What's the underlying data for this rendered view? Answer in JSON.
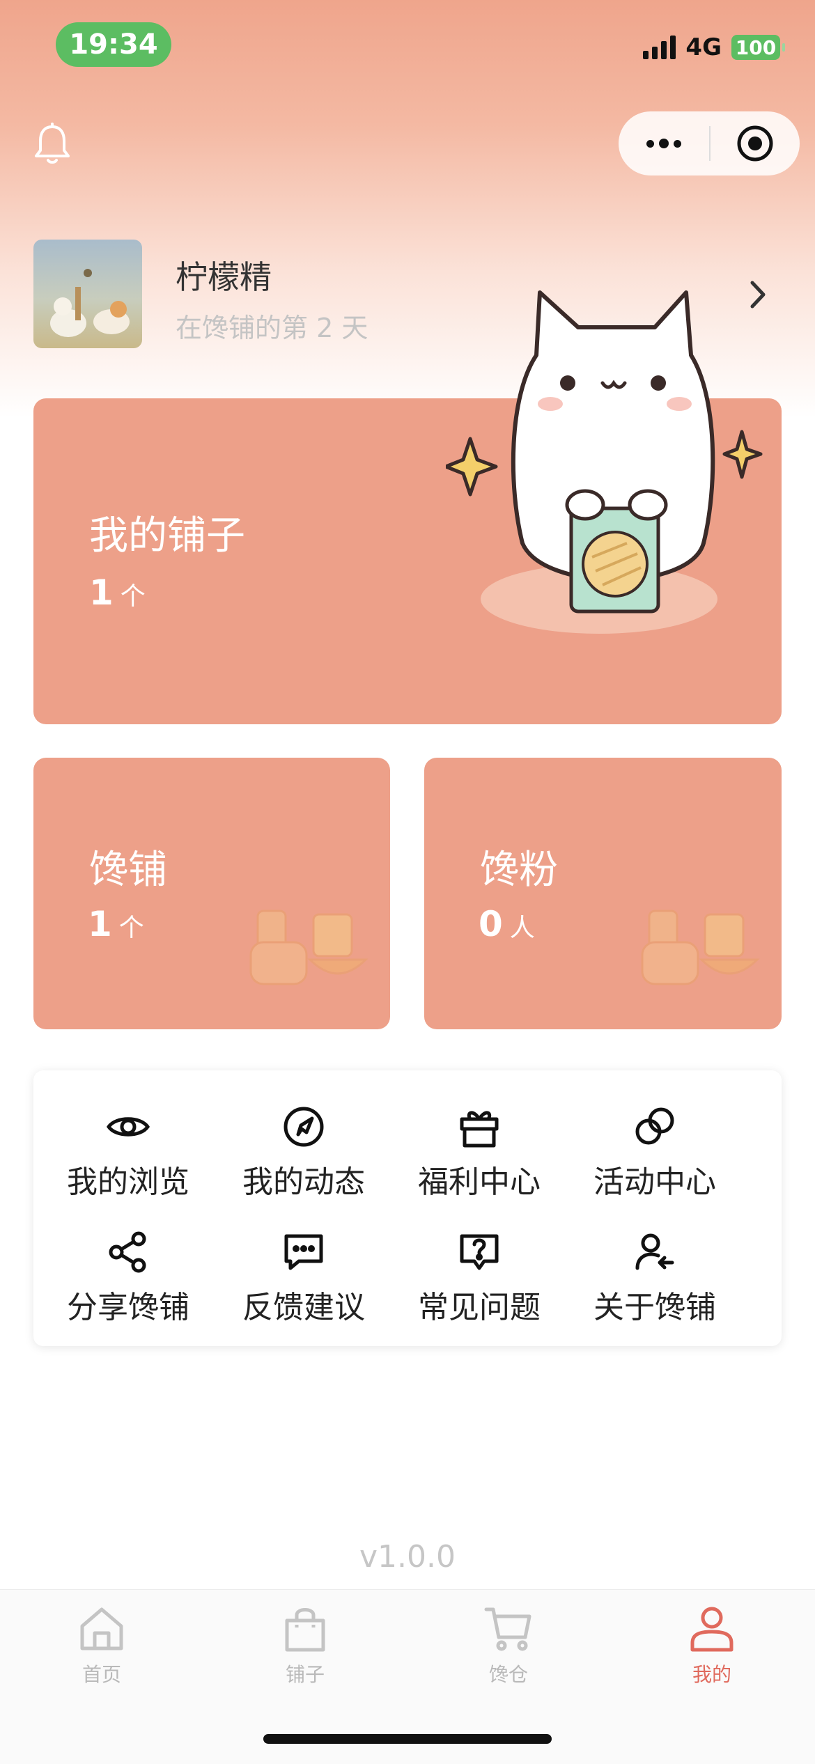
{
  "status_bar": {
    "time": "19:34",
    "network": "4G",
    "battery": "100"
  },
  "profile": {
    "name": "柠檬精",
    "days_text": "在馋铺的第 2 天"
  },
  "cards": {
    "my_shops": {
      "title": "我的铺子",
      "value": "1",
      "unit": "个"
    },
    "chanpu": {
      "title": "馋铺",
      "value": "1",
      "unit": "个"
    },
    "fans": {
      "title": "馋粉",
      "value": "0",
      "unit": "人"
    }
  },
  "menu": [
    {
      "label": "我的浏览",
      "icon": "eye-icon"
    },
    {
      "label": "我的动态",
      "icon": "compass-icon"
    },
    {
      "label": "福利中心",
      "icon": "gift-icon"
    },
    {
      "label": "活动中心",
      "icon": "coins-icon"
    },
    {
      "label": "分享馋铺",
      "icon": "share-icon"
    },
    {
      "label": "反馈建议",
      "icon": "chat-dots-icon"
    },
    {
      "label": "常见问题",
      "icon": "question-icon"
    },
    {
      "label": "关于馋铺",
      "icon": "user-arrow-icon"
    }
  ],
  "version": "v1.0.0",
  "tabs": [
    {
      "label": "首页",
      "icon": "home-icon",
      "active": false
    },
    {
      "label": "铺子",
      "icon": "bag-icon",
      "active": false
    },
    {
      "label": "馋仓",
      "icon": "cart-icon",
      "active": false
    },
    {
      "label": "我的",
      "icon": "person-icon",
      "active": true
    }
  ],
  "colors": {
    "accent": "#e06a5d",
    "card": "#eda089",
    "status_green": "#5cbd62"
  }
}
